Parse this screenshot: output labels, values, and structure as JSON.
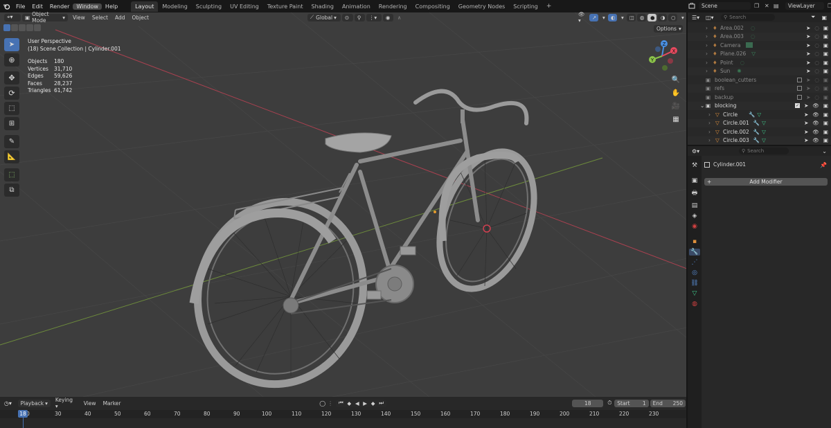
{
  "menubar": {
    "items": [
      "File",
      "Edit",
      "Render",
      "Window",
      "Help"
    ],
    "active": "Window"
  },
  "workspaces": [
    "Layout",
    "Modeling",
    "Sculpting",
    "UV Editing",
    "Texture Paint",
    "Shading",
    "Animation",
    "Rendering",
    "Compositing",
    "Geometry Nodes",
    "Scripting"
  ],
  "workspace_active": "Layout",
  "scene": {
    "label": "Scene",
    "viewlayer": "ViewLayer"
  },
  "viewport": {
    "mode": "Object Mode",
    "menus": [
      "View",
      "Select",
      "Add",
      "Object"
    ],
    "orientation": "Global",
    "options_label": "Options",
    "view_name": "User Perspective",
    "collection_line": "(18) Scene Collection | Cylinder.001",
    "stats": [
      {
        "label": "Objects",
        "value": "180"
      },
      {
        "label": "Vertices",
        "value": "31,710"
      },
      {
        "label": "Edges",
        "value": "59,626"
      },
      {
        "label": "Faces",
        "value": "28,237"
      },
      {
        "label": "Triangles",
        "value": "61,742"
      }
    ],
    "gizmo_axes": {
      "x": "X",
      "y": "Y",
      "z": "Z"
    }
  },
  "outliner": {
    "search_placeholder": "Search",
    "rows": [
      {
        "name": "Area.002",
        "kind": "light",
        "dim": true
      },
      {
        "name": "Area.003",
        "kind": "light",
        "dim": true
      },
      {
        "name": "Camera",
        "kind": "camera",
        "dim": true
      },
      {
        "name": "Plane.026",
        "kind": "mesh",
        "dim": true
      },
      {
        "name": "Point",
        "kind": "light",
        "dim": true
      },
      {
        "name": "Sun",
        "kind": "light",
        "dim": true
      },
      {
        "name": "boolean_cutters",
        "kind": "collection",
        "dim": true
      },
      {
        "name": "refs",
        "kind": "collection",
        "dim": true
      },
      {
        "name": "backup",
        "kind": "collection",
        "dim": true
      },
      {
        "name": "blocking",
        "kind": "collection",
        "dim": false
      },
      {
        "name": "Circle",
        "kind": "mesh",
        "dim": false
      },
      {
        "name": "Circle.001",
        "kind": "mesh",
        "dim": false
      },
      {
        "name": "Circle.002",
        "kind": "mesh",
        "dim": false
      },
      {
        "name": "Circle.003",
        "kind": "mesh",
        "dim": false
      }
    ]
  },
  "properties": {
    "search_placeholder": "Search",
    "object_name": "Cylinder.001",
    "add_modifier_label": "Add Modifier"
  },
  "timeline": {
    "menus": [
      "Playback",
      "Keying",
      "View",
      "Marker"
    ],
    "current_frame": "18",
    "start_label": "Start",
    "start_value": "1",
    "end_label": "End",
    "end_value": "250",
    "ticks": [
      "0",
      "30",
      "40",
      "50",
      "60",
      "70",
      "80",
      "90",
      "100",
      "110",
      "120",
      "130",
      "140",
      "150",
      "160",
      "170",
      "180",
      "190",
      "200",
      "210",
      "220",
      "230"
    ],
    "playhead": "18"
  },
  "colors": {
    "accent": "#4772b3",
    "x_axis": "#e84a5f",
    "y_axis": "#8bc34a",
    "z_axis": "#4a90e2",
    "playhead": "#4772b3"
  }
}
